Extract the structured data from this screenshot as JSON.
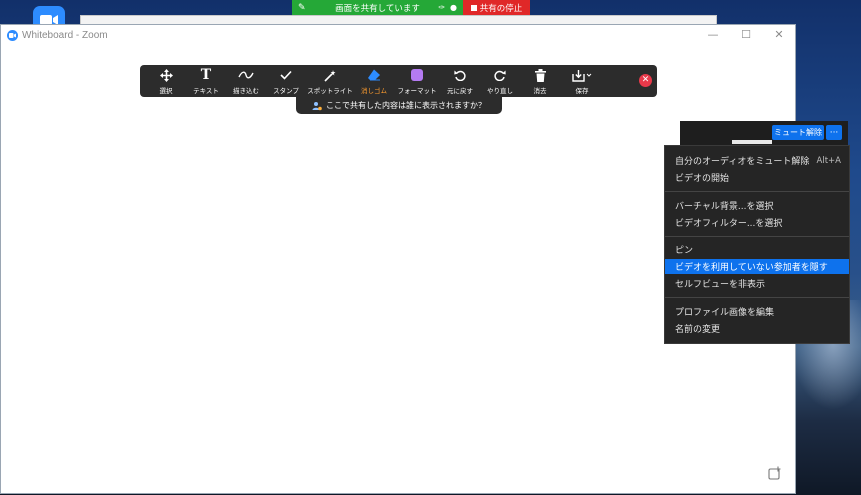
{
  "desktop": {
    "app_icon": "zoom-app-icon"
  },
  "window": {
    "title": "Whiteboard - Zoom",
    "minimize": "—",
    "maximize": "☐",
    "close": "✕"
  },
  "share_banner": {
    "label": "画面を共有しています",
    "stop_label": "共有の停止"
  },
  "toolbar": {
    "tools": [
      {
        "label": "選択",
        "icon": "move-icon"
      },
      {
        "label": "テキスト",
        "icon": "text-icon"
      },
      {
        "label": "描き込む",
        "icon": "draw-icon"
      },
      {
        "label": "スタンプ",
        "icon": "stamp-icon"
      },
      {
        "label": "スポットライト",
        "icon": "spotlight-icon"
      },
      {
        "label": "消しゴム",
        "icon": "eraser-icon"
      },
      {
        "label": "フォーマット",
        "icon": "format-icon"
      },
      {
        "label": "元に戻す",
        "icon": "undo-icon"
      },
      {
        "label": "やり直し",
        "icon": "redo-icon"
      },
      {
        "label": "消去",
        "icon": "trash-icon"
      },
      {
        "label": "保存",
        "icon": "save-icon"
      }
    ],
    "active_tool": "消しゴム",
    "format_color": "#b57bf2",
    "eraser_color": "#2d8cff",
    "who_can_see": "ここで共有した内容は誰に表示されますか？"
  },
  "video": {
    "unmute_label": "ミュート解除",
    "more_label": "···"
  },
  "menu": {
    "groups": [
      [
        {
          "label": "自分のオーディオをミュート解除",
          "shortcut": "Alt+A"
        },
        {
          "label": "ビデオの開始"
        }
      ],
      [
        {
          "label": "バーチャル背景...を選択"
        },
        {
          "label": "ビデオフィルター...を選択"
        }
      ],
      [
        {
          "label": "ピン"
        },
        {
          "label": "ビデオを利用していない参加者を隠す",
          "highlighted": true
        },
        {
          "label": "セルフビューを非表示"
        }
      ],
      [
        {
          "label": "プロファイル画像を編集"
        },
        {
          "label": "名前の変更"
        }
      ]
    ]
  }
}
